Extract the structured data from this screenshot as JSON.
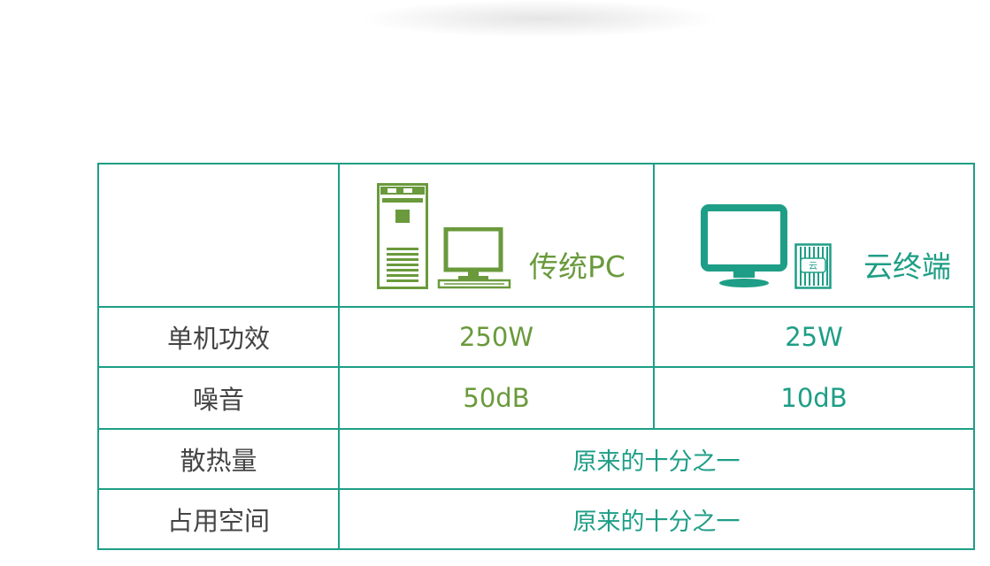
{
  "header": {
    "pc_label": "传统PC",
    "cloud_label": "云终端",
    "pc_icons": [
      "tower-pc-icon",
      "monitor-keyboard-icon"
    ],
    "cloud_icons": [
      "monitor-icon",
      "cloud-terminal-box-icon"
    ],
    "cloud_box_logo_text": "云"
  },
  "rows": [
    {
      "label": "单机功效",
      "pc": "250W",
      "cloud": "25W"
    },
    {
      "label": "噪音",
      "pc": "50dB",
      "cloud": "10dB"
    },
    {
      "label": "散热量",
      "shared": "原来的十分之一"
    },
    {
      "label": "占用空间",
      "shared": "原来的十分之一"
    }
  ],
  "colors": {
    "border": "#1e9e86",
    "pc_green": "#6a9a3c",
    "cloud_teal": "#1e9e86",
    "label_gray": "#444444"
  }
}
